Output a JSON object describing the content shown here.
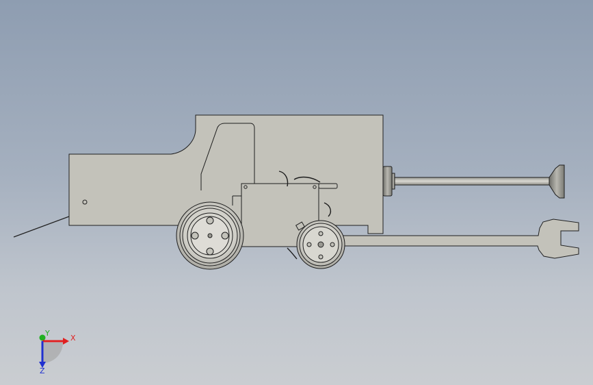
{
  "viewport": {
    "background_top": "#8e9db1",
    "background_bottom": "#cacdd1"
  },
  "model": {
    "part_fill": "#c3c2ba",
    "part_stroke": "#1e1e1e",
    "wheel_fill": "#d0cfc8",
    "components": [
      "main-body",
      "cab-window",
      "rear-platform",
      "gear-housing",
      "large-wheel",
      "small-wheel",
      "push-rod",
      "wrench-arm",
      "tow-cable"
    ]
  },
  "triad": {
    "x_label": "X",
    "y_label": "Y",
    "z_label": "Z",
    "x_color": "#e02020",
    "y_color": "#20b020",
    "z_color": "#2030d0"
  }
}
